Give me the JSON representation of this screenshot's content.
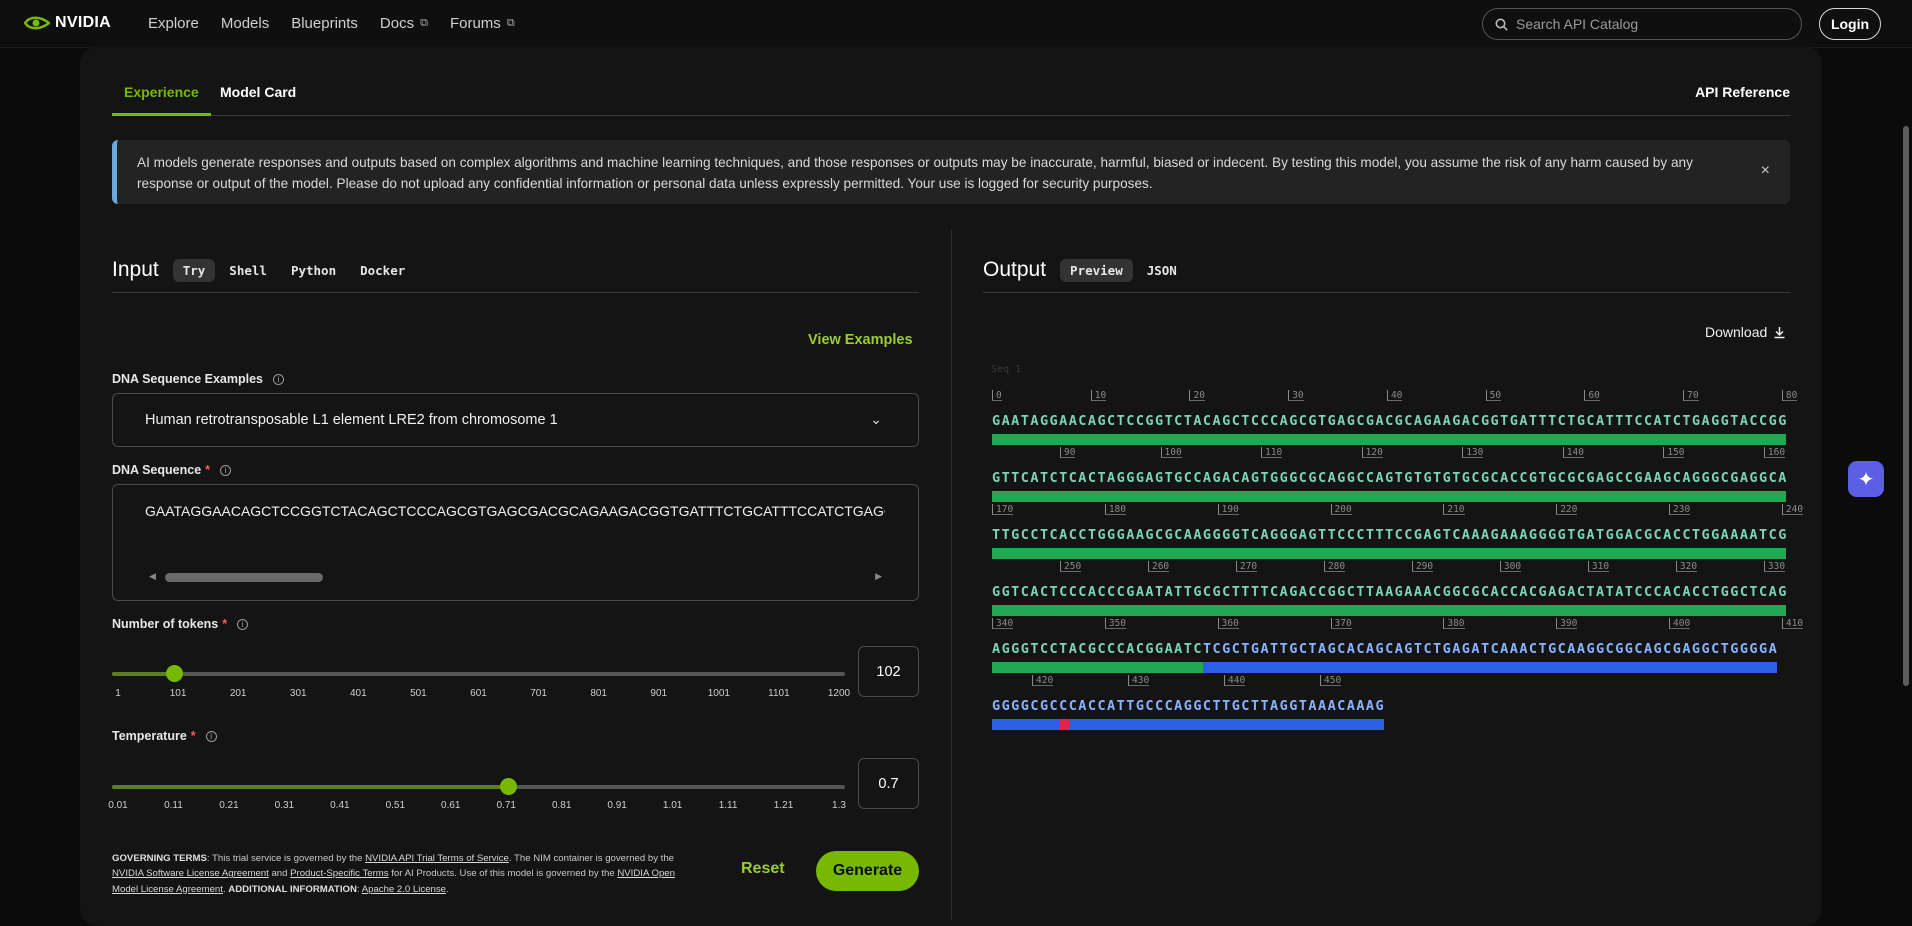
{
  "nav": {
    "brand": "NVIDIA",
    "links": [
      "Explore",
      "Models",
      "Blueprints",
      "Docs",
      "Forums"
    ],
    "search_placeholder": "Search API Catalog",
    "login": "Login"
  },
  "tabs": {
    "experience": "Experience",
    "model_card": "Model Card",
    "api_reference": "API Reference"
  },
  "notice": {
    "text": "AI models generate responses and outputs based on complex algorithms and machine learning techniques, and those responses or outputs may be inaccurate, harmful, biased or indecent. By testing this model, you assume the risk of any harm caused by any response or output of the model. Please do not upload any confidential information or personal data unless expressly permitted. Your use is logged for security purposes.",
    "close": "×"
  },
  "input": {
    "title": "Input",
    "modes": [
      "Try",
      "Shell",
      "Python",
      "Docker"
    ],
    "active_mode": "Try",
    "view_examples": "View Examples",
    "dna_examples_label": "DNA Sequence Examples",
    "dna_examples_value": "Human retrotransposable L1 element LRE2 from chromosome 1",
    "dna_sequence_label": "DNA Sequence",
    "dna_sequence_value": "GAATAGGAACAGCTCCGGTCTACAGCTCCCAGCGTGAGCGACGCAGAAGACGGTGATTTCTGCATTTCCATCTGAGGTAC",
    "tokens_label": "Number of tokens",
    "tokens_value": "102",
    "tokens_level": 0.085,
    "tokens_ticks": [
      "1",
      "101",
      "201",
      "301",
      "401",
      "501",
      "601",
      "701",
      "801",
      "901",
      "1001",
      "1101",
      "1200"
    ],
    "temperature_label": "Temperature",
    "temperature_value": "0.7",
    "temperature_level": 0.54,
    "temperature_ticks": [
      "0.01",
      "0.11",
      "0.21",
      "0.31",
      "0.41",
      "0.51",
      "0.61",
      "0.71",
      "0.81",
      "0.91",
      "1.01",
      "1.11",
      "1.21",
      "1.3"
    ],
    "reset": "Reset",
    "generate": "Generate"
  },
  "terms": {
    "governing_label": "GOVERNING TERMS",
    "t1": ": This trial service is governed by the ",
    "link1": "NVIDIA API Trial Terms of Service",
    "t2": ". The NIM container is governed by the ",
    "link2": "NVIDIA Software License Agreement",
    "t3": " and ",
    "link3": "Product-Specific Terms",
    "t4": " for AI Products. Use of this model is governed by the ",
    "link4": "NVIDIA Open Model License Agreement",
    "t5": ". ",
    "additional_label": "ADDITIONAL INFORMATION",
    "t6": ": ",
    "link5": "Apache 2.0 License",
    "t7": "."
  },
  "output": {
    "title": "Output",
    "modes": [
      "Preview",
      "JSON"
    ],
    "active_mode": "Preview",
    "download": "Download",
    "ghost_label": "Seq 1",
    "lines": [
      {
        "ticks": [
          "0",
          "10",
          "20",
          "30",
          "40",
          "50",
          "60",
          "70",
          "80"
        ],
        "prompt": "GAATAGGAACAGCTCCGGTCTACAGCTCCCAGCGTGAGCGACGCAGAAGACGGTGATTTCTGCATTTCCATCTGAGGTACCGG",
        "generated": ""
      },
      {
        "ticks": [
          "90",
          "100",
          "110",
          "120",
          "130",
          "140",
          "150",
          "160"
        ],
        "prompt": "GTTCATCTCACTAGGGAGTGCCAGACAGTGGGCGCAGGCCAGTGTGTGTGCGCACCGTGCGCGAGCCGAAGCAGGGCGAGGCA",
        "generated": ""
      },
      {
        "ticks": [
          "170",
          "180",
          "190",
          "200",
          "210",
          "220",
          "230",
          "240"
        ],
        "prompt": "TTGCCTCACCTGGGAAGCGCAAGGGGTCAGGGAGTTCCCTTTCCGAGTCAAAGAAAGGGGTGATGGACGCACCTGGAAAATCG",
        "generated": ""
      },
      {
        "ticks": [
          "250",
          "260",
          "270",
          "280",
          "290",
          "300",
          "310",
          "320",
          "330"
        ],
        "prompt": "GGTCACTCCCACCCGAATATTGCGCTTTTCAGACCGGCTTAAGAAACGGCGCACCACGAGACTATATCCCACACCTGGCTCAG",
        "generated": ""
      },
      {
        "ticks": [
          "340",
          "350",
          "360",
          "370",
          "380",
          "390",
          "400",
          "410"
        ],
        "prompt": "AGGGTCCTACGCCCACGGAATC",
        "generated": "TCGCTGATTGCTAGCACAGCAGTCTGAGATCAAACTGCAAGGCGGCAGCGAGGCTGGGGA"
      },
      {
        "ticks": [
          "420",
          "430",
          "440",
          "450"
        ],
        "prompt": "",
        "generated": "GGGGCGCCCACCATTGCCCAGGCTTGCTTAGGTAAACAAAG"
      }
    ]
  },
  "colors": {
    "accent": "#76b900",
    "prompt_bar": "#22a853",
    "generated_bar": "#2a5fe6",
    "mismatch": "#e0244e"
  }
}
